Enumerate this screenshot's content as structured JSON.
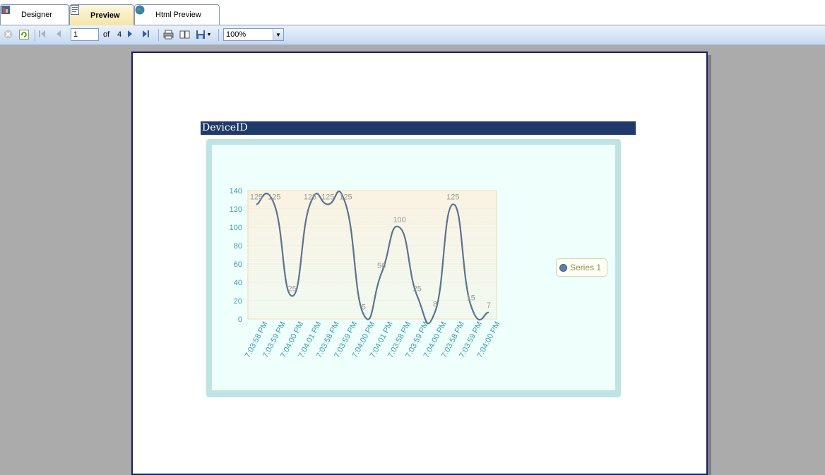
{
  "tabs": [
    {
      "label": "Designer",
      "icon": "designer-icon"
    },
    {
      "label": "Preview",
      "icon": "preview-icon",
      "active": true
    },
    {
      "label": "Html Preview",
      "icon": "globe-icon"
    }
  ],
  "toolbar": {
    "page_current": "1",
    "of_label": "of",
    "page_total": "4",
    "zoom": "100%",
    "icons": [
      "stop-icon",
      "refresh-icon",
      "first-page-icon",
      "previous-page-icon",
      "next-page-icon",
      "last-page-icon",
      "print-icon",
      "page-setup-icon",
      "save-icon",
      "dropdown-icon"
    ]
  },
  "report": {
    "header": "DeviceID"
  },
  "colors": {
    "header_bg": "#1f3a6a",
    "chart_frame": "#bde3e3",
    "chart_bg": "#effffb",
    "line": "#5a7391",
    "axis_text": "#3b9cb0",
    "label_text": "#9a9a9a"
  },
  "chart_data": {
    "type": "line",
    "smooth": true,
    "ylim": [
      0,
      140
    ],
    "yticks": [
      0,
      20,
      40,
      60,
      80,
      100,
      120,
      140
    ],
    "categories": [
      "7:03:58 PM",
      "7:03:59 PM",
      "7:04:00 PM",
      "7:04:01 PM",
      "7:03:58 PM",
      "7:03:59 PM",
      "7:04:00 PM",
      "7:04:01 PM",
      "7:03:58 PM",
      "7:03:59 PM",
      "7:04:00 PM",
      "7:03:58 PM",
      "7:03:59 PM",
      "7:04:00 PM"
    ],
    "series": [
      {
        "name": "Series 1",
        "values": [
          125,
          125,
          25,
          125,
          125,
          125,
          5,
          50,
          100,
          25,
          8,
          125,
          15,
          7
        ]
      }
    ],
    "data_labels": [
      "125",
      "125",
      "25",
      "125",
      "125",
      "125",
      "5",
      "50",
      "100",
      "25",
      "8",
      "125",
      "15",
      "7"
    ],
    "legend_position": "right",
    "grid": true
  }
}
